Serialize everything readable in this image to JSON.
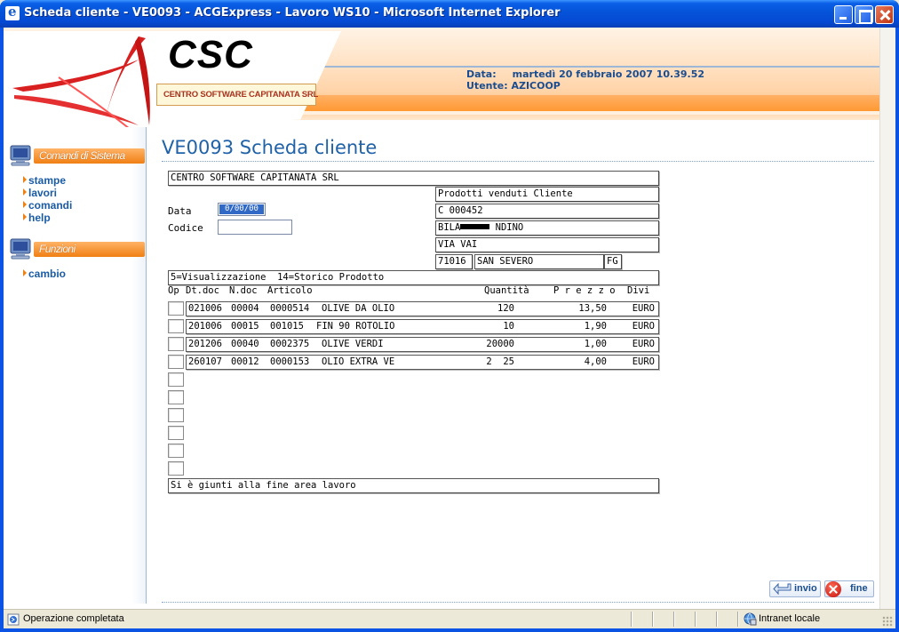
{
  "window": {
    "title": "Scheda cliente - VE0093 - ACGExpress - Lavoro WS10 - Microsoft Internet Explorer"
  },
  "header": {
    "logo_text": "CSC",
    "logo_subtitle": "CENTRO SOFTWARE CAPITANATA SRL",
    "date_label": "Data:",
    "date_value": "martedì 20 febbraio 2007 10.39.52",
    "user_label": "Utente:",
    "user_value": "AZICOOP"
  },
  "sidebar": {
    "system_title": "Comandi di Sistema",
    "system_items": [
      "stampe",
      "lavori",
      "comandi",
      "help"
    ],
    "functions_title": "Funzioni",
    "function_items": [
      "cambio"
    ]
  },
  "page": {
    "title": "VE0093 Scheda cliente",
    "company": "CENTRO SOFTWARE CAPITANATA SRL",
    "data_label": "Data",
    "data_value": "0/00/00",
    "codice_label": "Codice",
    "section_title": "Prodotti venduti Cliente",
    "client_code": "C 000452",
    "client_name_prefix": "BILA",
    "client_name_suffix": " NDINO",
    "client_address": "VIA VAI",
    "client_cap": "71016",
    "client_city": "SAN SEVERO",
    "client_province": "FG",
    "options": "5=Visualizzazione  14=Storico Prodotto",
    "columns": {
      "op": "Op",
      "dtdoc": "Dt.doc",
      "ndoc": "N.doc",
      "articolo": "Articolo",
      "quantita": "Quantità",
      "prezzo": "P r e z z o",
      "divisa": "Divi"
    },
    "rows": [
      {
        "dtdoc": "021006",
        "ndoc": "00004",
        "codice": "0000514",
        "articolo": "OLIVE DA OLIO",
        "quantita": "120",
        "prezzo": "13,50",
        "divisa": "EURO"
      },
      {
        "dtdoc": "201006",
        "ndoc": "00015",
        "codice": "001015",
        "articolo": "FIN 90 ROTOLIO",
        "quantita": "10",
        "prezzo": "1,90",
        "divisa": "EURO"
      },
      {
        "dtdoc": "201206",
        "ndoc": "00040",
        "codice": "0002375",
        "articolo": "OLIVE VERDI",
        "quantita": "20000",
        "prezzo": "1,00",
        "divisa": "EURO"
      },
      {
        "dtdoc": "260107",
        "ndoc": "00012",
        "codice": "0000153",
        "articolo": "OLIO EXTRA VE",
        "quantita": "2  25",
        "prezzo": "4,00",
        "divisa": "EURO"
      }
    ],
    "footer_message": "Si è giunti alla fine area lavoro"
  },
  "buttons": {
    "invio": "invio",
    "fine": "fine"
  },
  "statusbar": {
    "text": "Operazione completata",
    "zone": "Intranet locale"
  }
}
